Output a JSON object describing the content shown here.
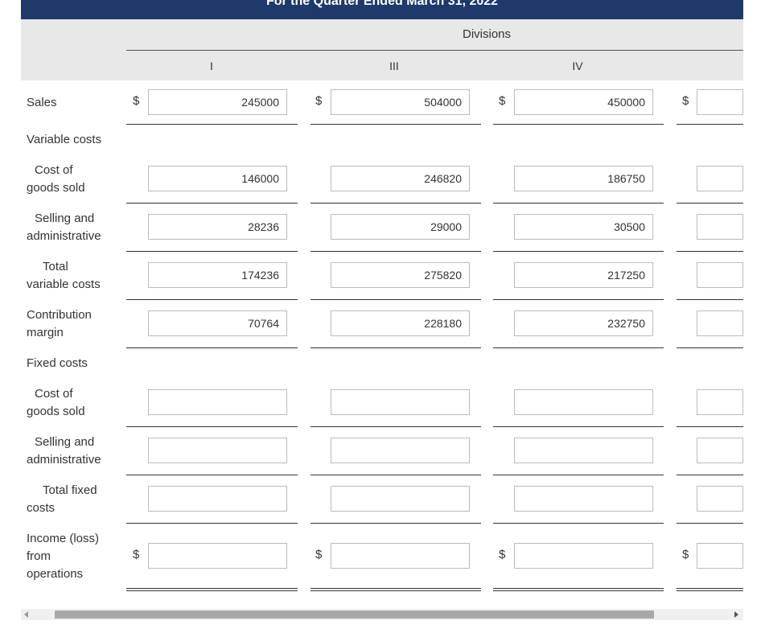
{
  "header": {
    "title": "For the Quarter Ended March 31, 2022",
    "divisions_label": "Divisions",
    "columns": [
      "I",
      "III",
      "IV"
    ]
  },
  "rows": {
    "sales": {
      "label": "Sales",
      "values": [
        "245000",
        "504000",
        "450000",
        ""
      ]
    },
    "variable_costs": {
      "label": "Variable costs"
    },
    "var_cogs": {
      "label_l1": "Cost of",
      "label_l2": "goods sold",
      "values": [
        "146000",
        "246820",
        "186750",
        ""
      ]
    },
    "var_sga": {
      "label_l1": "Selling and",
      "label_l2": "administrative",
      "values": [
        "28236",
        "29000",
        "30500",
        ""
      ]
    },
    "total_var": {
      "label_l1": "Total",
      "label_l2": "variable costs",
      "values": [
        "174236",
        "275820",
        "217250",
        ""
      ]
    },
    "contribution": {
      "label_l1": "Contribution",
      "label_l2": "margin",
      "values": [
        "70764",
        "228180",
        "232750",
        ""
      ]
    },
    "fixed_costs": {
      "label": "Fixed costs"
    },
    "fix_cogs": {
      "label_l1": "Cost of",
      "label_l2": "goods sold",
      "values": [
        "",
        "",
        "",
        ""
      ]
    },
    "fix_sga": {
      "label_l1": "Selling and",
      "label_l2": "administrative",
      "values": [
        "",
        "",
        "",
        ""
      ]
    },
    "total_fixed": {
      "label_l1": "Total fixed",
      "label_l2": "costs",
      "values": [
        "",
        "",
        "",
        ""
      ]
    },
    "income": {
      "label_l1": "Income (loss)",
      "label_l2": "from",
      "label_l3": "operations",
      "values": [
        "",
        "",
        "",
        ""
      ]
    }
  },
  "currency_symbol": "$"
}
